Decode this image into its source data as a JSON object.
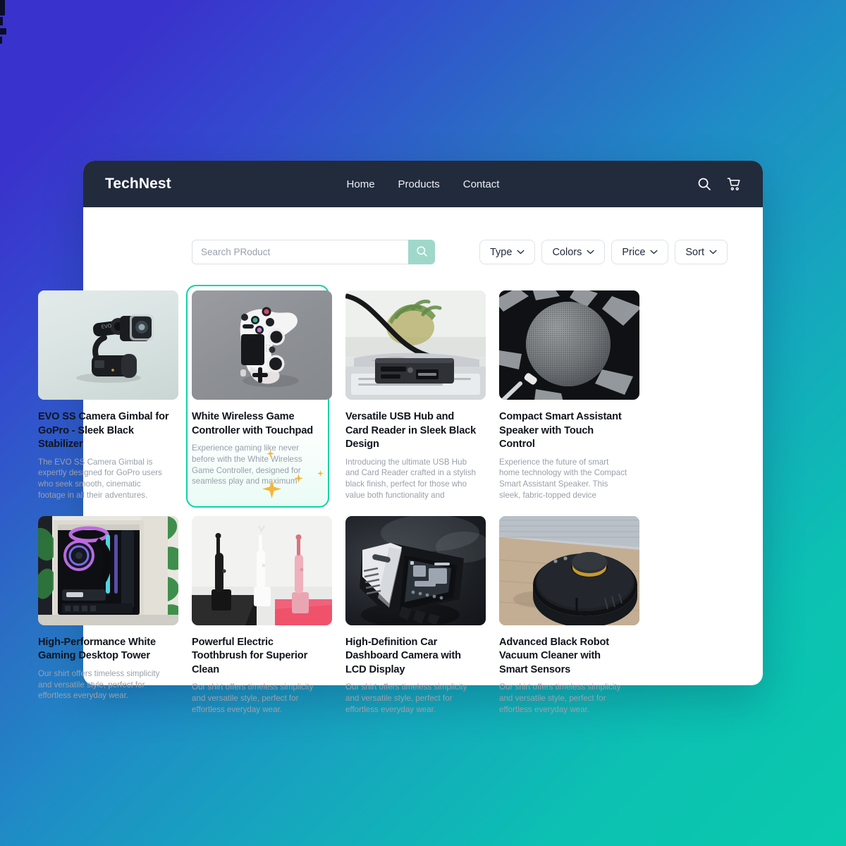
{
  "header": {
    "brand": "TechNest",
    "nav": [
      {
        "label": "Home"
      },
      {
        "label": "Products"
      },
      {
        "label": "Contact"
      }
    ],
    "actions": [
      {
        "name": "search-icon"
      },
      {
        "name": "cart-icon"
      }
    ]
  },
  "search": {
    "value": "",
    "placeholder": "Search PRoduct",
    "button_icon": "search-icon",
    "button_color": "#9fd8cb"
  },
  "filters": [
    {
      "label": "Type"
    },
    {
      "label": "Colors"
    },
    {
      "label": "Price"
    },
    {
      "label": "Sort"
    }
  ],
  "theme": {
    "navbar_bg": "#222b3c",
    "selection_border": "#0ed2a8",
    "sparkle_color": "#f3b73c",
    "muted_text": "#9aa0aa",
    "bg_gradient_from": "#3a32cc",
    "bg_gradient_mid": "#1f8cc6",
    "bg_gradient_to": "#0acaad"
  },
  "products": [
    {
      "title": "EVO SS Camera Gimbal for GoPro - Sleek Black Stabilizer",
      "description": "The EVO SS Camera Gimbal is expertly designed for GoPro users who seek smooth, cinematic footage in all their adventures.",
      "image": "camera-gimbal",
      "selected": false
    },
    {
      "title": "White Wireless Game Controller with Touchpad",
      "description": "Experience gaming like never before with the White Wireless Game Controller, designed for seamless play and maximum comfort.",
      "image": "game-controller",
      "selected": true
    },
    {
      "title": "Versatile USB Hub and Card Reader in Sleek Black Design",
      "description": "Introducing the ultimate USB Hub and Card Reader crafted in a stylish black finish, perfect for those who value both functionality and aesthetics.",
      "image": "usb-hub",
      "selected": false
    },
    {
      "title": "Compact Smart Assistant Speaker with Touch Control",
      "description": "Experience the future of smart home technology with the Compact Smart Assistant Speaker. This sleek, fabric-topped device seamlessly blends style",
      "image": "smart-speaker",
      "selected": false
    },
    {
      "title": "High-Performance White Gaming Desktop Tower",
      "description": "Our shirt offers timeless simplicity and versatile style, perfect for effortless everyday wear.",
      "image": "gaming-desktop",
      "selected": false
    },
    {
      "title": "Powerful Electric Toothbrush for Superior Clean",
      "description": "Our shirt offers timeless simplicity and versatile style, perfect for effortless everyday wear.",
      "image": "electric-toothbrush",
      "selected": false
    },
    {
      "title": "High-Definition Car Dashboard Camera with LCD Display",
      "description": "Our shirt offers timeless simplicity and versatile style, perfect for effortless everyday wear.",
      "image": "dashboard-camera",
      "selected": false
    },
    {
      "title": "Advanced Black Robot Vacuum Cleaner with Smart Sensors",
      "description": "Our shirt offers timeless simplicity and versatile style, perfect for effortless everyday wear.",
      "image": "robot-vacuum",
      "selected": false
    }
  ]
}
